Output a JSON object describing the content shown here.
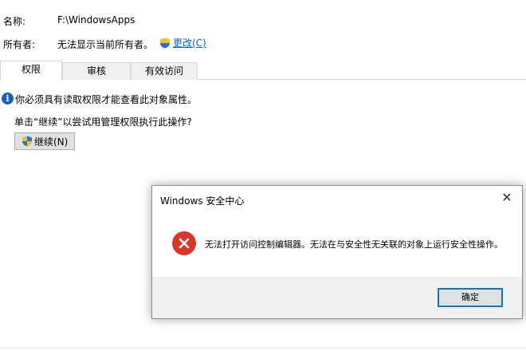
{
  "properties": {
    "name_label": "名称:",
    "name_value": "F:\\WindowsApps",
    "owner_label": "所有者:",
    "owner_value": "无法显示当前所有者。",
    "change_link": "更改(C)"
  },
  "tabs": [
    {
      "label": "权限",
      "active": true
    },
    {
      "label": "审核",
      "active": false
    },
    {
      "label": "有效访问",
      "active": false
    }
  ],
  "info": {
    "icon": "info-icon",
    "message": "你必须具有读取权限才能查看此对象属性。",
    "prompt": "单击“继续”以尝试用管理权限执行此操作?",
    "continue_label": "继续(N)"
  },
  "dialog": {
    "title": "Windows 安全中心",
    "close_glyph": "✕",
    "icon": "error-icon",
    "message": "无法打开访问控制编辑器。无法在与安全性无关联的对象上运行安全性操作。",
    "ok_label": "确定"
  },
  "colors": {
    "accent": "#0078d7",
    "link": "#0066cc",
    "error": "#d9362b",
    "info": "#1a5fb4"
  }
}
